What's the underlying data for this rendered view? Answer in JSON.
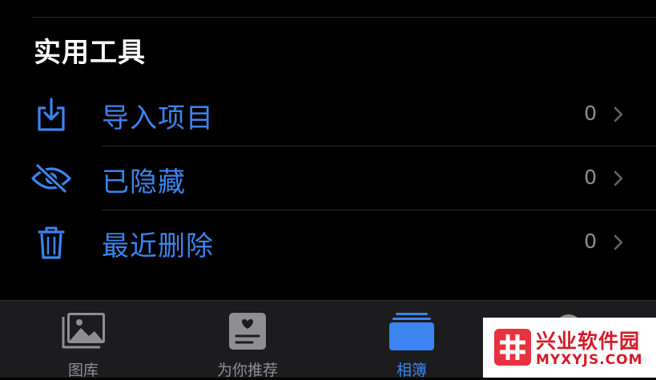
{
  "section": {
    "title": "实用工具"
  },
  "utilities": {
    "items": [
      {
        "label": "导入项目",
        "count": "0",
        "icon": "import-icon"
      },
      {
        "label": "已隐藏",
        "count": "0",
        "icon": "eye-slash-icon"
      },
      {
        "label": "最近删除",
        "count": "0",
        "icon": "trash-icon"
      }
    ]
  },
  "tabbar": {
    "tabs": [
      {
        "label": "图库",
        "icon": "photo-library-icon"
      },
      {
        "label": "为你推荐",
        "icon": "for-you-icon"
      },
      {
        "label": "相簿",
        "icon": "albums-icon",
        "active": true
      },
      {
        "label": "",
        "icon": "search-icon"
      }
    ]
  },
  "watermark": {
    "name": "兴业软件园",
    "domain": "MYXYJS.COM"
  },
  "colors": {
    "accent": "#3c84f0",
    "background": "#000000",
    "tabbar": "#1c1c1e",
    "muted": "#8e8e93",
    "watermark_red": "#d61a2a"
  }
}
